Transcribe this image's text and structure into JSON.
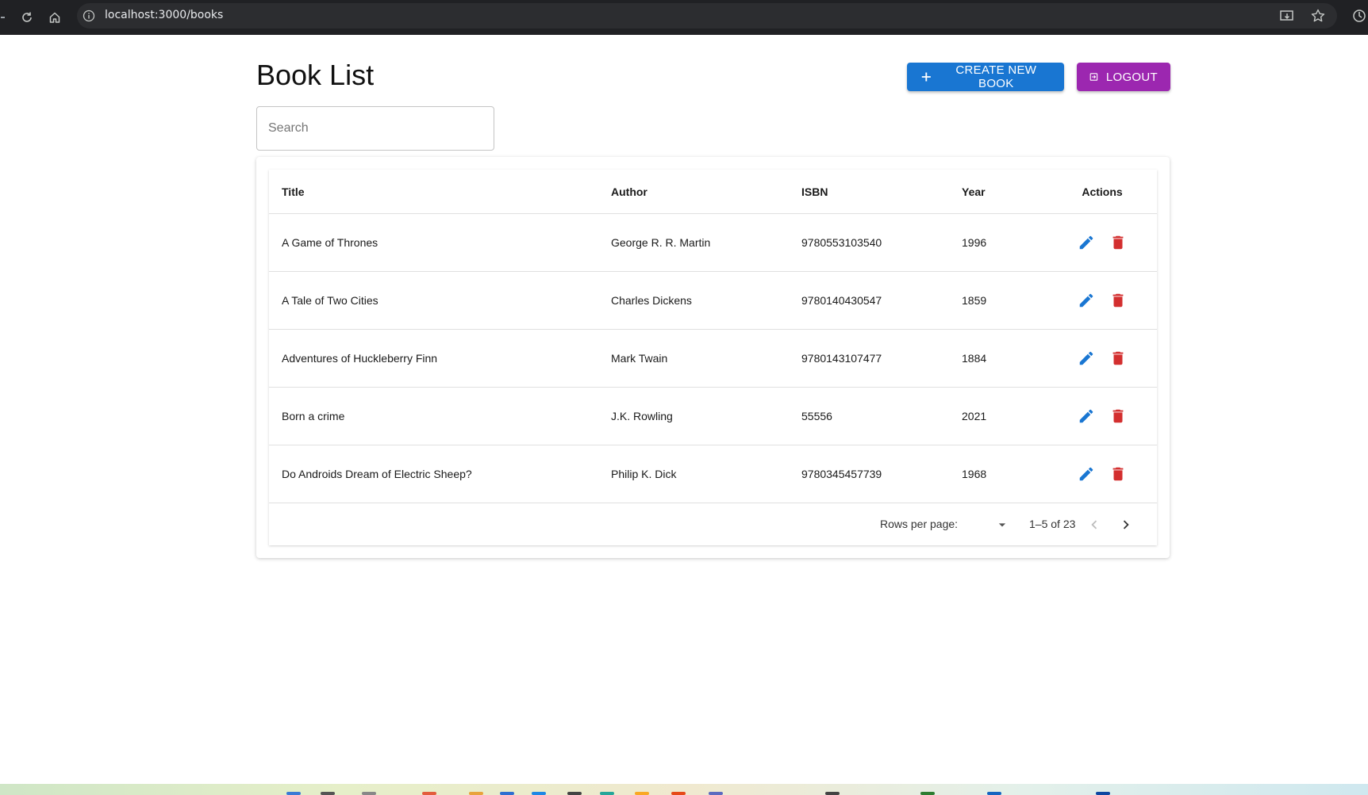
{
  "browser": {
    "url": "localhost:3000/books"
  },
  "page": {
    "title": "Book List",
    "create_button_label": "CREATE NEW BOOK",
    "logout_button_label": "LOGOUT",
    "search_placeholder": "Search",
    "search_value": ""
  },
  "table": {
    "columns": [
      "Title",
      "Author",
      "ISBN",
      "Year",
      "Actions"
    ],
    "rows": [
      {
        "title": "A Game of Thrones",
        "author": "George R. R. Martin",
        "isbn": "9780553103540",
        "year": "1996"
      },
      {
        "title": "A Tale of Two Cities",
        "author": "Charles Dickens",
        "isbn": "9780140430547",
        "year": "1859"
      },
      {
        "title": "Adventures of Huckleberry Finn",
        "author": "Mark Twain",
        "isbn": "9780143107477",
        "year": "1884"
      },
      {
        "title": "Born a crime",
        "author": "J.K. Rowling",
        "isbn": "55556",
        "year": "2021"
      },
      {
        "title": "Do Androids Dream of Electric Sheep?",
        "author": "Philip K. Dick",
        "isbn": "9780345457739",
        "year": "1968"
      }
    ],
    "row_actions": [
      "edit-icon",
      "delete-icon"
    ]
  },
  "pagination": {
    "rows_per_page_label": "Rows per page:",
    "range_text": "1–5 of 23"
  },
  "colors": {
    "primary": "#1976d2",
    "secondary": "#9c27b0",
    "danger": "#d32f2f",
    "browser_chrome": "#202124"
  }
}
